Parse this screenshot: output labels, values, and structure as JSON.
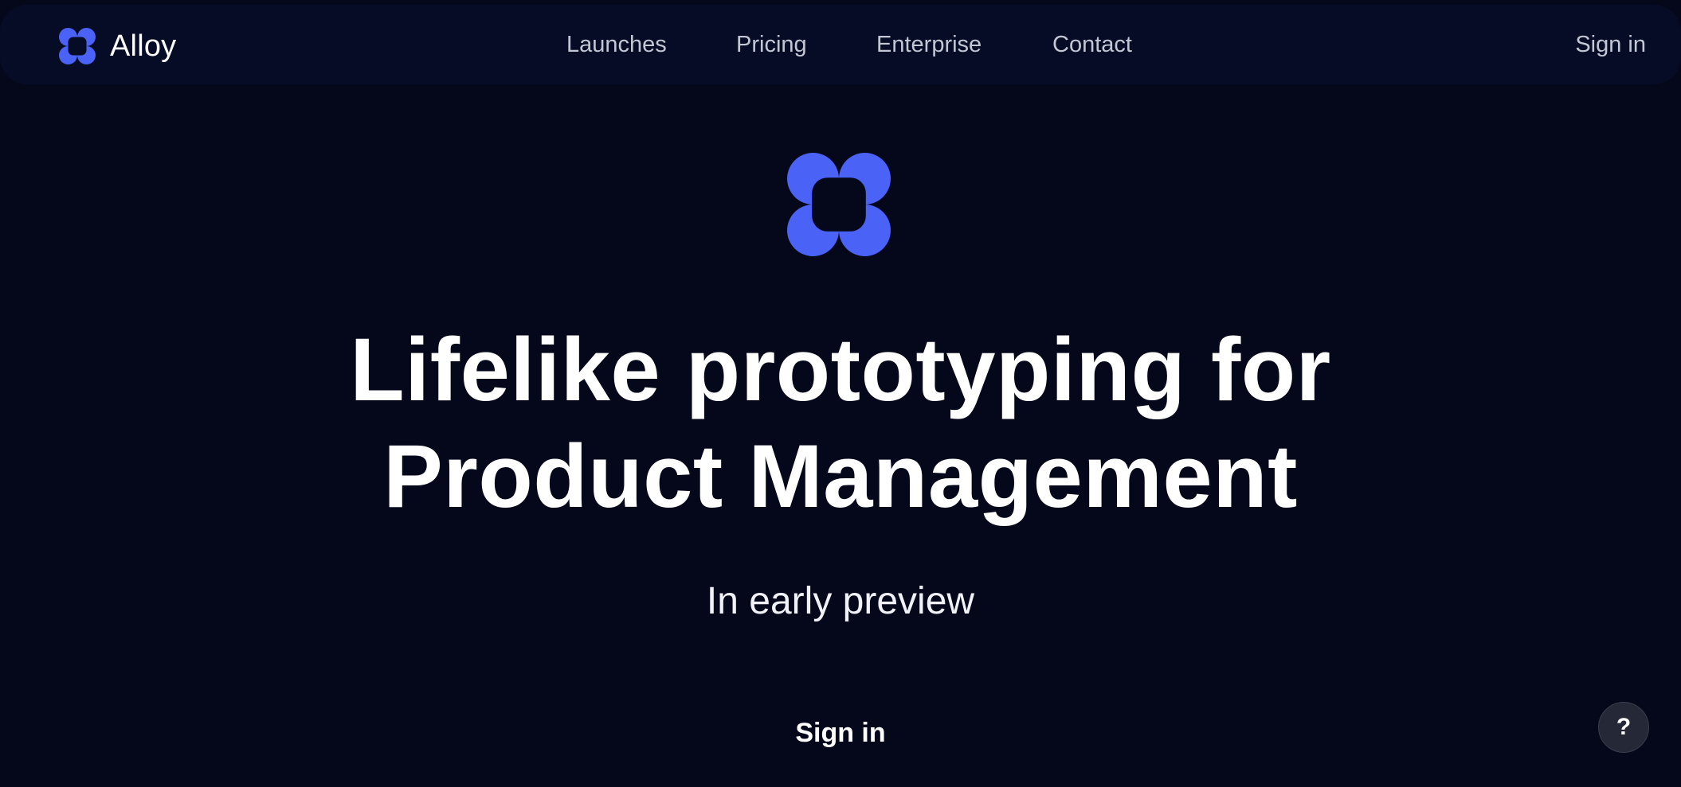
{
  "brand": {
    "name": "Alloy",
    "logo_icon": "alloy-logo-icon",
    "accent_color": "#4a62f5"
  },
  "nav": {
    "items": [
      {
        "label": "Launches"
      },
      {
        "label": "Pricing"
      },
      {
        "label": "Enterprise"
      },
      {
        "label": "Contact"
      }
    ],
    "sign_in_label": "Sign in"
  },
  "hero": {
    "title_line1": "Lifelike prototyping for",
    "title_line2": "Product Management",
    "subtitle": "In early preview",
    "sign_in_label": "Sign in"
  },
  "help": {
    "label": "?",
    "icon": "help-icon"
  },
  "colors": {
    "background": "#05071a",
    "navbar": "#070c26",
    "nav_text": "#c3c6d3"
  }
}
